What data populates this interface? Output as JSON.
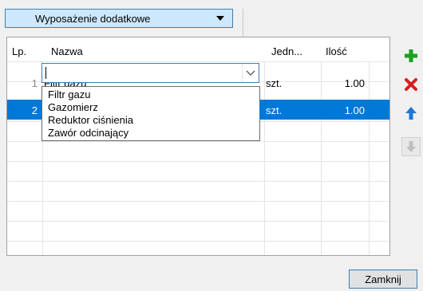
{
  "equipment_dropdown": {
    "label": "Wyposażenie dodatkowe"
  },
  "table": {
    "headers": {
      "lp": "Lp.",
      "name": "Nazwa",
      "unit": "Jedn...",
      "qty": "Ilość"
    },
    "rows": [
      {
        "lp": "1",
        "name": "Filtr gazu",
        "unit": "szt.",
        "qty": "1.00"
      },
      {
        "lp": "2",
        "name": "",
        "unit": "szt.",
        "qty": "1.00"
      }
    ]
  },
  "name_dropdown": {
    "options": [
      "Filtr gazu",
      "Gazomierz",
      "Reduktor ciśnienia",
      "Zawór odcinający"
    ]
  },
  "side_toolbar": {
    "add": "plus-icon",
    "delete": "x-icon",
    "move_up": "up-arrow-icon",
    "move_down": "down-arrow-icon"
  },
  "footer": {
    "close_label": "Zamknij"
  },
  "colors": {
    "selection": "#0078d7",
    "accent_border": "#3c7fb1",
    "add_green": "#1ea01e",
    "delete_red": "#d42020"
  }
}
